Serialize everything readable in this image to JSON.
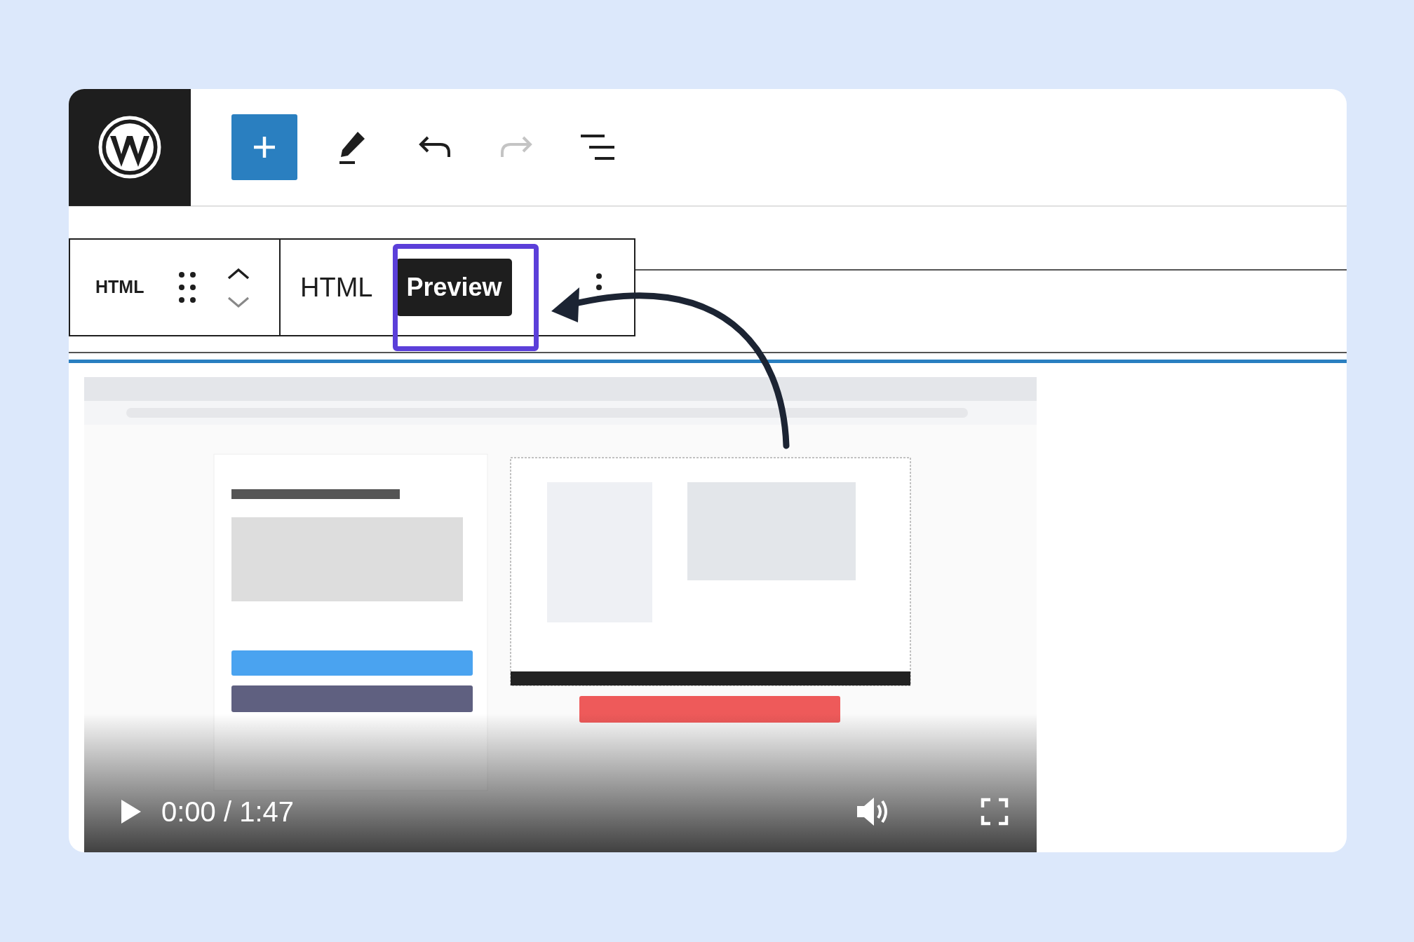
{
  "top_toolbar": {
    "history": [
      {
        "kind": "undo",
        "disabled": false
      },
      {
        "kind": "redo",
        "disabled": true
      }
    ]
  },
  "block_toolbar": {
    "block_label": "HTML",
    "tabs": [
      {
        "label": "HTML",
        "selected": false
      },
      {
        "label": "Preview",
        "selected": true
      }
    ]
  },
  "video": {
    "time": "0:00 / 1:47"
  }
}
